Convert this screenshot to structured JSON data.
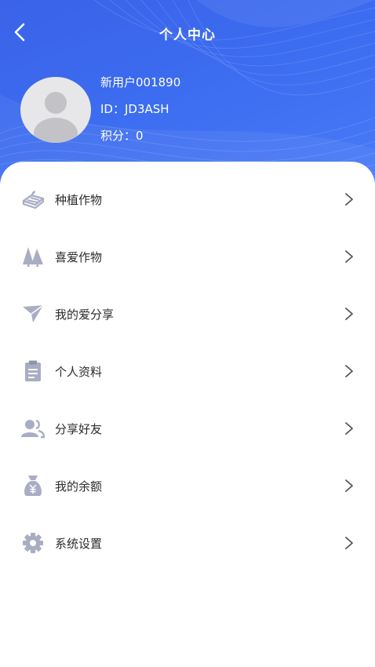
{
  "header": {
    "title": "个人中心",
    "back_icon": "chevron-left-icon",
    "background_color": "#3c6cf0"
  },
  "user": {
    "name": "新用户001890",
    "id_label": "ID：",
    "id_value": "JD3ASH",
    "points_label": "积分：",
    "points_value": "0"
  },
  "menu": {
    "items": [
      {
        "label": "种植作物",
        "icon": "planting-bed-icon"
      },
      {
        "label": "喜爱作物",
        "icon": "trees-icon"
      },
      {
        "label": "我的爱分享",
        "icon": "paper-plane-icon"
      },
      {
        "label": "个人资料",
        "icon": "clipboard-icon"
      },
      {
        "label": "分享好友",
        "icon": "users-icon"
      },
      {
        "label": "我的余额",
        "icon": "money-bag-icon"
      },
      {
        "label": "系统设置",
        "icon": "gear-icon"
      }
    ],
    "icon_color": "#a9adc4",
    "chevron_icon": "chevron-right-icon"
  }
}
